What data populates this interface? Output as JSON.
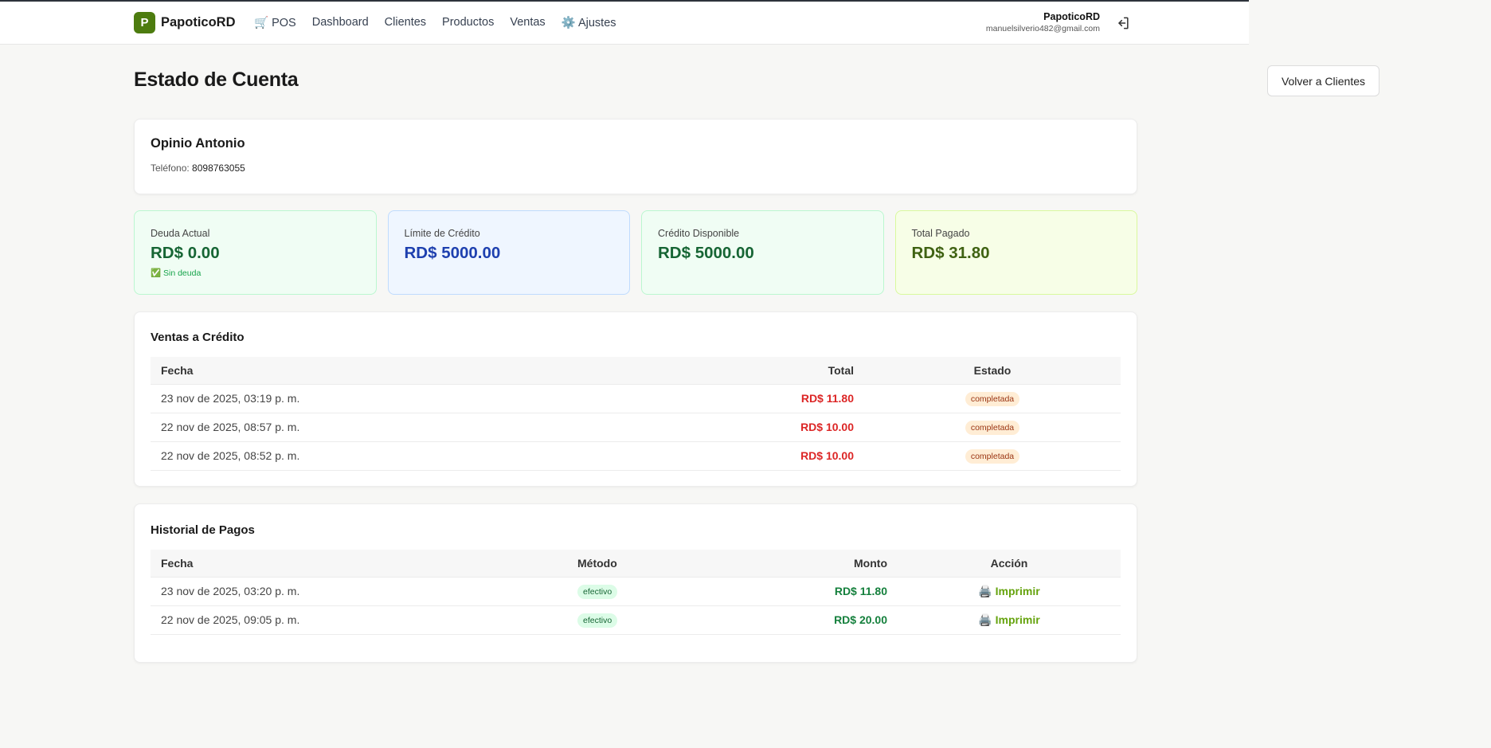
{
  "header": {
    "logo_letter": "P",
    "brand": "PapoticoRD",
    "nav": [
      "🛒 POS",
      "Dashboard",
      "Clientes",
      "Productos",
      "Ventas",
      "⚙️ Ajustes"
    ],
    "user_name": "PapoticoRD",
    "user_email": "manuelsilverio482@gmail.com",
    "logout_icon": "logout-icon"
  },
  "page": {
    "title": "Estado de Cuenta",
    "back_label": "Volver a Clientes"
  },
  "client": {
    "name": "Opinio Antonio",
    "phone_label": "Teléfono:",
    "phone": "8098763055"
  },
  "stats": [
    {
      "label": "Deuda Actual",
      "value": "RD$ 0.00",
      "note": "✅ Sin deuda",
      "color": "#166534"
    },
    {
      "label": "Límite de Crédito",
      "value": "RD$ 5000.00",
      "color": "#1e40af"
    },
    {
      "label": "Crédito Disponible",
      "value": "RD$ 5000.00",
      "color": "#166534"
    },
    {
      "label": "Total Pagado",
      "value": "RD$ 31.80",
      "color": "#3f6212"
    }
  ],
  "sales": {
    "title": "Ventas a Crédito",
    "headers": [
      "Fecha",
      "Total",
      "Estado"
    ],
    "rows": [
      {
        "date": "23 nov de 2025, 03:19 p. m.",
        "total": "RD$ 11.80",
        "status": "completada"
      },
      {
        "date": "22 nov de 2025, 08:57 p. m.",
        "total": "RD$ 10.00",
        "status": "completada"
      },
      {
        "date": "22 nov de 2025, 08:52 p. m.",
        "total": "RD$ 10.00",
        "status": "completada"
      }
    ]
  },
  "payments": {
    "title": "Historial de Pagos",
    "headers": [
      "Fecha",
      "Método",
      "Monto",
      "Acción"
    ],
    "rows": [
      {
        "date": "23 nov de 2025, 03:20 p. m.",
        "method": "efectivo",
        "amount": "RD$ 11.80",
        "action": "🖨️ Imprimir"
      },
      {
        "date": "22 nov de 2025, 09:05 p. m.",
        "method": "efectivo",
        "amount": "RD$ 20.00",
        "action": "🖨️ Imprimir"
      }
    ]
  }
}
